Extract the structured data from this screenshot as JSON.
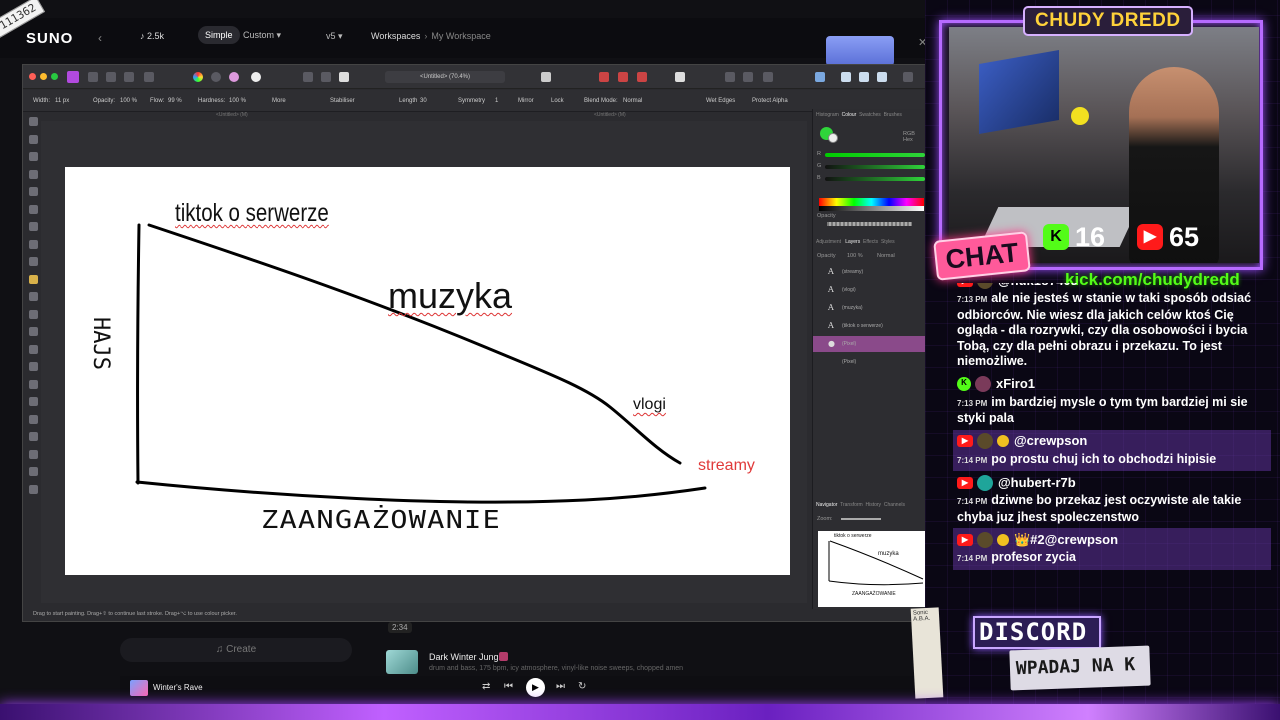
{
  "suno": {
    "logo": "SUNO",
    "credits": "♪ 2.5k",
    "mode_simple": "Simple",
    "mode_custom": "Custom",
    "version": "v5",
    "breadcrumb_root": "Workspaces",
    "breadcrumb_current": "My Workspace",
    "create_label": "♫ Create",
    "duration": "2:34",
    "song_title": "Dark Winter Jungle",
    "song_desc": "drum and bass, 175 bpm, icy atmosphere, vinyl-like noise sweeps, chopped amen",
    "now_playing": "Winter's Rave"
  },
  "affinity": {
    "doc_title": "<Untitled> (70.4%)",
    "context": {
      "width_label": "Width:",
      "width_value": "11 px",
      "opacity_label": "Opacity:",
      "opacity_value": "100 %",
      "flow_label": "Flow:",
      "flow_value": "99 %",
      "hardness_label": "Hardness:",
      "hardness_value": "100 %",
      "more": "More",
      "stabiliser": "Stabiliser",
      "length_label": "Length",
      "length_value": "30",
      "symmetry_label": "Symmetry",
      "symmetry_value": "1",
      "mirror": "Mirror",
      "lock": "Lock",
      "blend_label": "Blend Mode:",
      "blend_value": "Normal",
      "wet_edges": "Wet Edges",
      "protect_alpha": "Protect Alpha"
    },
    "tab_left": "<Untitled> (M)",
    "tab_right": "<Untitled> (M)",
    "status": "Drag to start painting. Drag+⇧ to continue last stroke. Drag+⌥ to use colour picker.",
    "panels": {
      "top_tabs": [
        "Histogram",
        "Colour",
        "Swatches",
        "Brushes"
      ],
      "active_top": "Colour",
      "rgb_mode": "RGB Hex",
      "channels": [
        "R",
        "G",
        "B"
      ],
      "opacity_label": "Opacity",
      "mid_tabs": [
        "Adjustment",
        "Layers",
        "Effects",
        "Styles"
      ],
      "active_mid": "Layers",
      "layer_opacity": "100 %",
      "layer_blend": "Normal",
      "layers": [
        "(streamy)",
        "(vlogi)",
        "(muzyka)",
        "(tiktok o serwerze)",
        "(Pixel)",
        "(Pixel)"
      ],
      "bottom_tabs": [
        "Navigator",
        "Transform",
        "History",
        "Channels"
      ],
      "zoom_label": "Zoom:"
    },
    "artboard": {
      "label_tiktok": "tiktok o serwerze",
      "label_muzyka": "muzyka",
      "label_vlogi": "vlogi",
      "label_streamy": "streamy",
      "x_axis_label": "ZAANGAŻOWANIE",
      "y_axis_label": "HAJS"
    }
  },
  "overlay": {
    "streamer_name": "CHUDY DREDD",
    "chat_sign": "CHAT",
    "kick_viewers": "16",
    "youtube_viewers": "65",
    "kick_url": "kick.com/chudydredd",
    "discord_title": "DISCORD",
    "discord_sub": "WPADAJ NA K",
    "sticker_text": "Sonic A.B.A.",
    "corner_tag": "111362",
    "chat_messages": [
      {
        "platform": "youtube",
        "user": "@nuk1o7409",
        "time": "7:13 PM",
        "text": "ale nie jesteś w stanie w taki sposób odsiać odbiorców. Nie wiesz dla jakich celów ktoś Cię ogląda - dla rozrywki, czy dla osobowości i bycia Tobą, czy dla pełni obrazu i przekazu. To jest niemożliwe.",
        "highlight": false
      },
      {
        "platform": "kick",
        "user": "xFiro1",
        "time": "7:13 PM",
        "text": "im bardziej mysle o tym tym bardziej mi sie styki pala",
        "highlight": false
      },
      {
        "platform": "youtube",
        "user": "@crewpson",
        "time": "7:14 PM",
        "text": "po prostu chuj ich to obchodzi hipisie",
        "highlight": true
      },
      {
        "platform": "youtube",
        "user": "@hubert-r7b",
        "time": "7:14 PM",
        "text": "dziwne bo przekaz jest oczywiste ale takie chyba juz jhest spoleczenstwo",
        "highlight": false
      },
      {
        "platform": "youtube",
        "user": "👑#2@crewpson",
        "time": "7:14 PM",
        "text": "profesor zycia",
        "highlight": true
      }
    ]
  }
}
